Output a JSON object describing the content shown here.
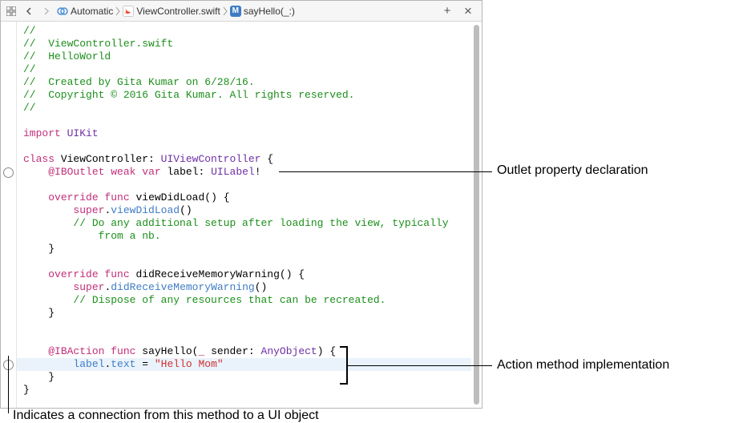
{
  "jumpbar": {
    "back_glyph": "‹",
    "forward_glyph": "›",
    "crumbs": [
      {
        "icon": "related-icon",
        "label": "Automatic"
      },
      {
        "icon": "swift-file-icon",
        "label": "ViewController.swift"
      },
      {
        "icon": "method-icon",
        "icon_letter": "M",
        "label": "sayHello(_:)"
      }
    ],
    "add_glyph": "+",
    "close_glyph": "×"
  },
  "gutter": {
    "connection_dots": [
      {
        "line": 11
      },
      {
        "line": 26
      }
    ]
  },
  "code": {
    "highlight_line": 27,
    "lines": [
      [
        [
          "c-comment",
          "//"
        ]
      ],
      [
        [
          "c-comment",
          "//  ViewController.swift"
        ]
      ],
      [
        [
          "c-comment",
          "//  HelloWorld"
        ]
      ],
      [
        [
          "c-comment",
          "//"
        ]
      ],
      [
        [
          "c-comment",
          "//  Created by Gita Kumar on 6/28/16."
        ]
      ],
      [
        [
          "c-comment",
          "//  Copyright © 2016 Gita Kumar. All rights reserved."
        ]
      ],
      [
        [
          "c-comment",
          "//"
        ]
      ],
      [
        [
          "",
          ""
        ]
      ],
      [
        [
          "c-kw",
          "import"
        ],
        [
          "",
          " "
        ],
        [
          "c-type",
          "UIKit"
        ]
      ],
      [
        [
          "",
          ""
        ]
      ],
      [
        [
          "c-kw",
          "class"
        ],
        [
          "",
          " "
        ],
        [
          "",
          "ViewController: "
        ],
        [
          "c-type",
          "UIViewController"
        ],
        [
          "",
          " {"
        ]
      ],
      [
        [
          "",
          "    "
        ],
        [
          "c-kw",
          "@IBOutlet"
        ],
        [
          "",
          " "
        ],
        [
          "c-kw",
          "weak"
        ],
        [
          "",
          " "
        ],
        [
          "c-kw",
          "var"
        ],
        [
          "",
          " label: "
        ],
        [
          "c-type",
          "UILabel"
        ],
        [
          "",
          "!"
        ]
      ],
      [
        [
          "",
          ""
        ]
      ],
      [
        [
          "",
          "    "
        ],
        [
          "c-kw",
          "override"
        ],
        [
          "",
          " "
        ],
        [
          "c-kw",
          "func"
        ],
        [
          "",
          " viewDidLoad() {"
        ]
      ],
      [
        [
          "",
          "        "
        ],
        [
          "c-kw",
          "super"
        ],
        [
          "",
          "."
        ],
        [
          "c-call",
          "viewDidLoad"
        ],
        [
          "",
          "()"
        ]
      ],
      [
        [
          "",
          "        "
        ],
        [
          "c-comment",
          "// Do any additional setup after loading the view, typically"
        ]
      ],
      [
        [
          "",
          "            "
        ],
        [
          "c-comment",
          "from a nb."
        ]
      ],
      [
        [
          "",
          "    }"
        ]
      ],
      [
        [
          "",
          ""
        ]
      ],
      [
        [
          "",
          "    "
        ],
        [
          "c-kw",
          "override"
        ],
        [
          "",
          " "
        ],
        [
          "c-kw",
          "func"
        ],
        [
          "",
          " didReceiveMemoryWarning() {"
        ]
      ],
      [
        [
          "",
          "        "
        ],
        [
          "c-kw",
          "super"
        ],
        [
          "",
          "."
        ],
        [
          "c-call",
          "didReceiveMemoryWarning"
        ],
        [
          "",
          "()"
        ]
      ],
      [
        [
          "",
          "        "
        ],
        [
          "c-comment",
          "// Dispose of any resources that can be recreated."
        ]
      ],
      [
        [
          "",
          "    }"
        ]
      ],
      [
        [
          "",
          ""
        ]
      ],
      [
        [
          "",
          ""
        ]
      ],
      [
        [
          "",
          "    "
        ],
        [
          "c-kw",
          "@IBAction"
        ],
        [
          "",
          " "
        ],
        [
          "c-kw",
          "func"
        ],
        [
          "",
          " sayHello("
        ],
        [
          "c-kw",
          "_"
        ],
        [
          "",
          " sender: "
        ],
        [
          "c-type",
          "AnyObject"
        ],
        [
          "",
          ") {"
        ]
      ],
      [
        [
          "",
          "        "
        ],
        [
          "c-call",
          "label"
        ],
        [
          "",
          "."
        ],
        [
          "c-call",
          "text"
        ],
        [
          "",
          " = "
        ],
        [
          "c-str",
          "\"Hello Mom\""
        ]
      ],
      [
        [
          "",
          "    }"
        ]
      ],
      [
        [
          "",
          "}"
        ]
      ]
    ]
  },
  "annotations": {
    "outlet": "Outlet property declaration",
    "action": "Action method implementation",
    "connection": "Indicates a connection from this method to a UI object"
  }
}
